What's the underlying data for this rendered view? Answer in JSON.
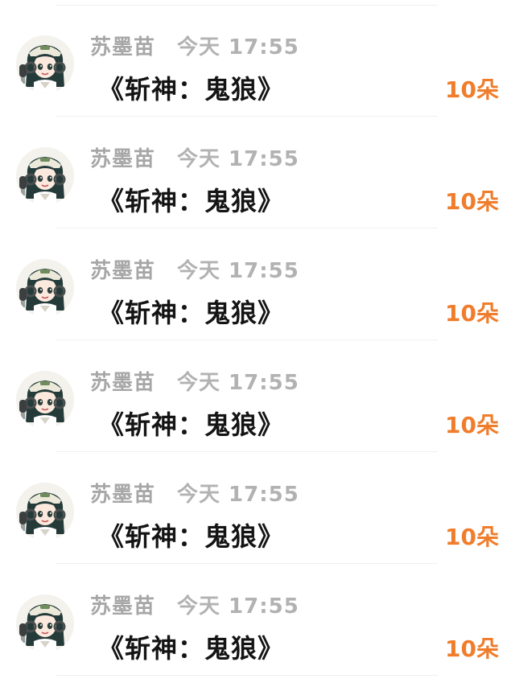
{
  "gift_list": {
    "items": [
      {
        "sender_name": "苏墨苗",
        "timestamp": "今天 17:55",
        "message": "《斩神：鬼狼》",
        "amount": "10朵"
      },
      {
        "sender_name": "苏墨苗",
        "timestamp": "今天 17:55",
        "message": "《斩神：鬼狼》",
        "amount": "10朵"
      },
      {
        "sender_name": "苏墨苗",
        "timestamp": "今天 17:55",
        "message": "《斩神：鬼狼》",
        "amount": "10朵"
      },
      {
        "sender_name": "苏墨苗",
        "timestamp": "今天 17:55",
        "message": "《斩神：鬼狼》",
        "amount": "10朵"
      },
      {
        "sender_name": "苏墨苗",
        "timestamp": "今天 17:55",
        "message": "《斩神：鬼狼》",
        "amount": "10朵"
      },
      {
        "sender_name": "苏墨苗",
        "timestamp": "今天 17:55",
        "message": "《斩神：鬼狼》",
        "amount": "10朵"
      }
    ]
  },
  "colors": {
    "amount": "#f07d2c",
    "name": "#a7a7a7",
    "timestamp": "#b2b2b2",
    "message": "#141414"
  }
}
